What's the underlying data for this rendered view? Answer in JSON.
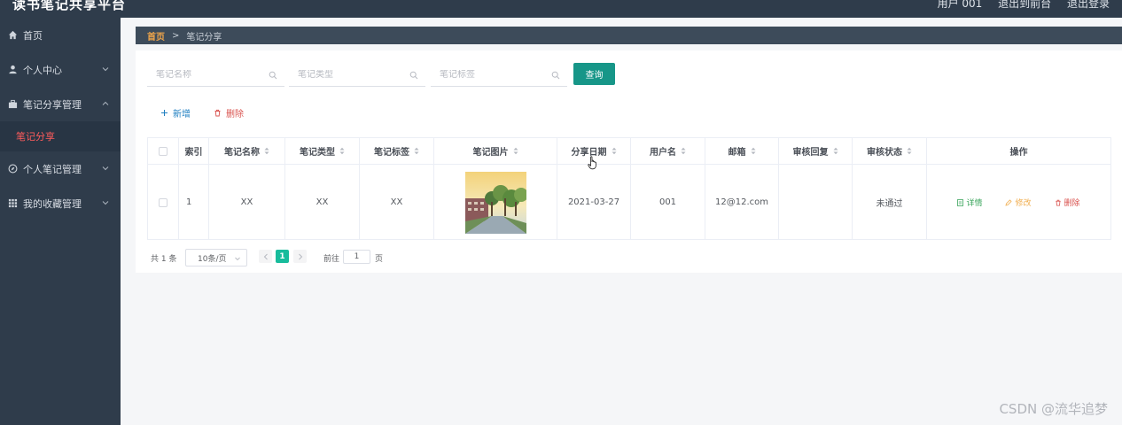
{
  "app": {
    "title": "读书笔记共享平台"
  },
  "topbar": {
    "user_label": "用户 001",
    "links": [
      "退出到前台",
      "退出登录"
    ]
  },
  "sidebar": {
    "items": [
      {
        "label": "首页",
        "icon": "home-icon"
      },
      {
        "label": "个人中心",
        "icon": "user-icon"
      },
      {
        "label": "笔记分享管理",
        "icon": "briefcase-icon",
        "expanded": true
      },
      {
        "label": "个人笔记管理",
        "icon": "compass-icon"
      },
      {
        "label": "我的收藏管理",
        "icon": "grid-icon"
      }
    ],
    "active_sub": "笔记分享"
  },
  "breadcrumb": {
    "home": "首页",
    "separator": ">",
    "current": "笔记分享"
  },
  "search": {
    "fields": [
      {
        "placeholder": "笔记名称",
        "value": ""
      },
      {
        "placeholder": "笔记类型",
        "value": ""
      },
      {
        "placeholder": "笔记标签",
        "value": ""
      }
    ],
    "query_label": "查询"
  },
  "actions": {
    "add_label": "新增",
    "delete_label": "删除"
  },
  "table": {
    "headers": [
      "索引",
      "笔记名称",
      "笔记类型",
      "笔记标签",
      "笔记图片",
      "分享日期",
      "用户名",
      "邮箱",
      "审核回复",
      "审核状态",
      "操作"
    ],
    "rows": [
      {
        "index": "1",
        "name": "XX",
        "type": "XX",
        "tag": "XX",
        "date": "2021-03-27",
        "username": "001",
        "email": "12@12.com",
        "reply": "",
        "status": "未通过",
        "ops": {
          "detail": "详情",
          "edit": "修改",
          "remove": "删除"
        }
      }
    ]
  },
  "pagination": {
    "total_text": "共 1 条",
    "page_size": "10条/页",
    "current_page": "1",
    "goto_label": "前往",
    "goto_value": "1",
    "page_unit": "页"
  },
  "watermark": "CSDN @流华追梦",
  "colors": {
    "primary": "#179688",
    "sidebar": "#2f3c4b",
    "active_sub": "#ff5c5c",
    "breadcrumb_home": "#f0a54a"
  }
}
